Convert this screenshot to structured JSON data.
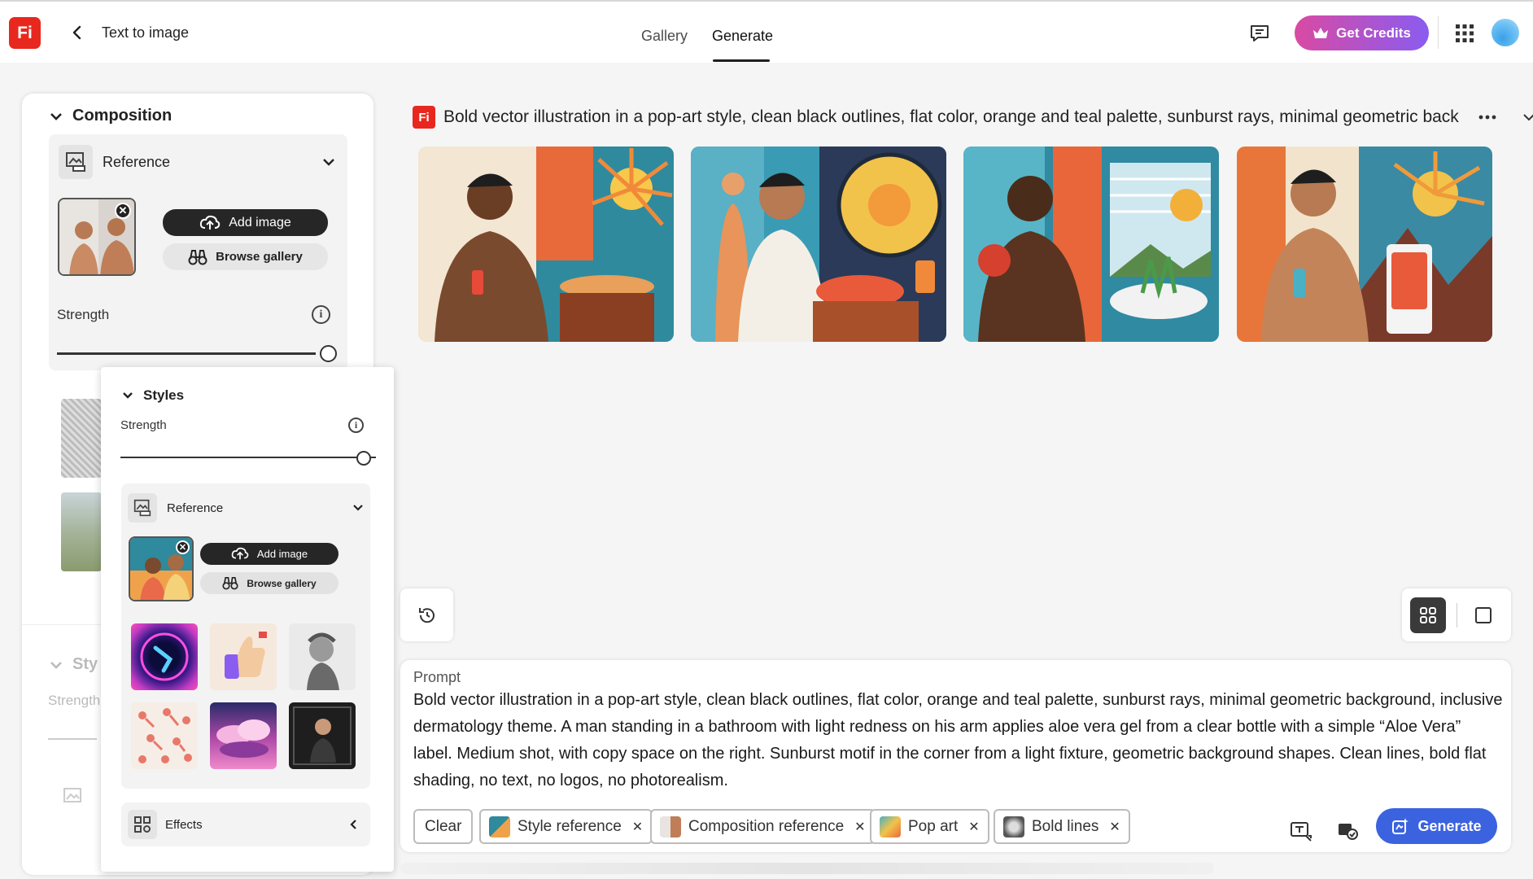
{
  "header": {
    "logo_text": "Fi",
    "back_label": "Text to image",
    "tabs": [
      {
        "label": "Gallery"
      },
      {
        "label": "Generate"
      }
    ],
    "credits_label": "Get Credits",
    "accent_gradient": [
      "#d94aa3",
      "#8a5cf0"
    ]
  },
  "composition": {
    "title": "Composition",
    "reference_label": "Reference",
    "add_image_label": "Add image",
    "browse_gallery_label": "Browse gallery",
    "strength_label": "Strength",
    "strength_value": 1.0
  },
  "styles_behind": {
    "title": "Sty",
    "strength": "Strength"
  },
  "styles": {
    "title": "Styles",
    "strength_label": "Strength",
    "strength_value": 1.0,
    "reference_label": "Reference",
    "add_image_label": "Add image",
    "browse_gallery_label": "Browse gallery",
    "presets": [
      "neon-figure",
      "3d-thumbs-up",
      "sketch-portrait",
      "pattern-hands",
      "pink-clouds",
      "dark-portrait"
    ],
    "effects_label": "Effects"
  },
  "result": {
    "title": "Bold vector illustration in a pop-art style, clean black outlines, flat color, orange and teal palette, sunburst rays, minimal geometric background, inclusive dermatology theme. A man standing in a bathroom with light redness on his arm applies aloe vera gel from a clear bottle with a simple “Aloe Vera” label.",
    "images": [
      "generated-image-1",
      "generated-image-2",
      "generated-image-3",
      "generated-image-4"
    ]
  },
  "prompt": {
    "label": "Prompt",
    "text": "Bold vector illustration in a pop-art style, clean black outlines, flat color, orange and teal palette, sunburst rays, minimal geometric background, inclusive dermatology theme. A man standing in a bathroom with light redness on his arm applies aloe vera gel from a clear bottle with a simple “Aloe Vera” label. Medium shot, with copy space on the right. Sunburst motif in the corner from a light fixture, geometric background shapes. Clean lines, bold flat shading, no text, no logos, no photorealism.",
    "clear_label": "Clear",
    "chips": [
      {
        "label": "Style reference"
      },
      {
        "label": "Composition reference"
      },
      {
        "label": "Pop art"
      },
      {
        "label": "Bold lines"
      }
    ],
    "generate_label": "Generate",
    "generate_color": "#3b63e0"
  }
}
